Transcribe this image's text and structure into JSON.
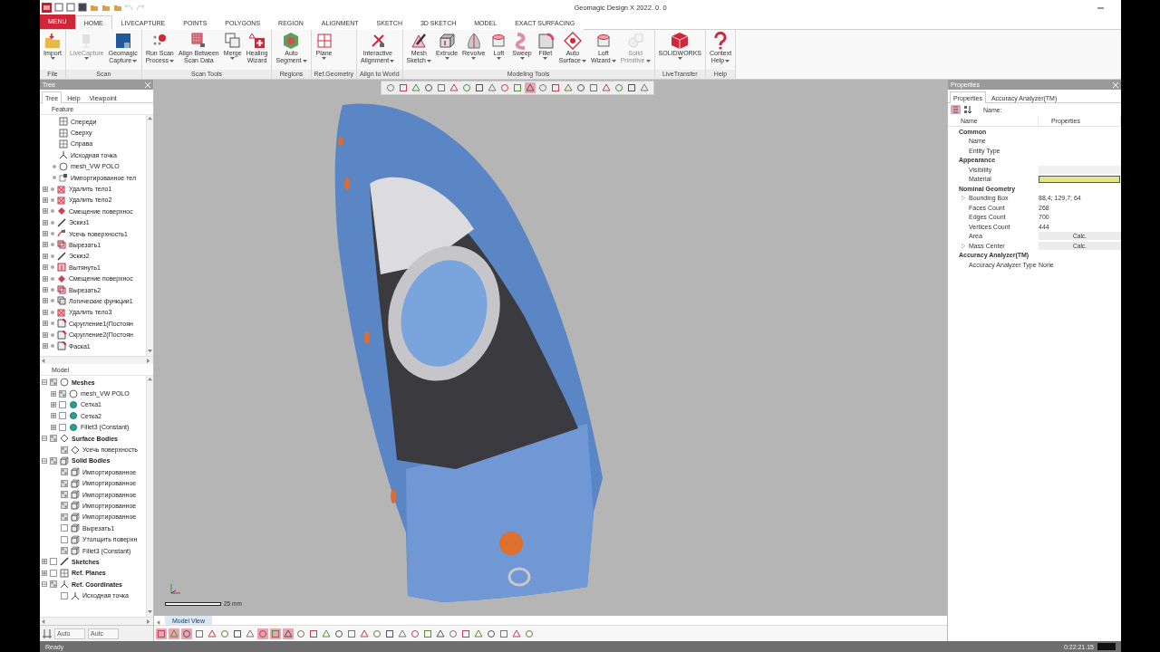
{
  "window": {
    "title": "Geomagic Design X 2022. 0. 0"
  },
  "menu_button": {
    "label": "MENU"
  },
  "ribbon_tabs": [
    {
      "label": "HOME",
      "selected": true
    },
    {
      "label": "LIVECAPTURE",
      "selected": false
    },
    {
      "label": "POINTS",
      "selected": false
    },
    {
      "label": "POLYGONS",
      "selected": false
    },
    {
      "label": "REGION",
      "selected": false
    },
    {
      "label": "ALIGNMENT",
      "selected": false
    },
    {
      "label": "SKETCH",
      "selected": false
    },
    {
      "label": "3D SKETCH",
      "selected": false
    },
    {
      "label": "MODEL",
      "selected": false
    },
    {
      "label": "EXACT SURFACING",
      "selected": false
    }
  ],
  "ribbon_groups": [
    {
      "label": "File",
      "buttons": [
        {
          "lines": [
            "Import"
          ],
          "kind": "folder",
          "dropdown": true,
          "disabled": false
        }
      ]
    },
    {
      "label": "Scan",
      "buttons": [
        {
          "lines": [
            "LiveCapture"
          ],
          "kind": "scanner",
          "dropdown": true,
          "disabled": true
        },
        {
          "lines": [
            "Geomagic",
            "Capture"
          ],
          "kind": "badge",
          "dropdown": true,
          "disabled": false
        }
      ]
    },
    {
      "label": "Scan Tools",
      "buttons": [
        {
          "lines": [
            "Run Scan",
            "Process"
          ],
          "kind": "dots",
          "dropdown": true,
          "disabled": false
        },
        {
          "lines": [
            "Align Between",
            "Scan Data"
          ],
          "kind": "grid",
          "dropdown": false,
          "disabled": false
        },
        {
          "lines": [
            "Merge"
          ],
          "kind": "overlap",
          "dropdown": true,
          "disabled": false
        },
        {
          "lines": [
            "Healing",
            "Wizard"
          ],
          "kind": "cross",
          "dropdown": false,
          "disabled": false
        }
      ]
    },
    {
      "label": "Regions",
      "buttons": [
        {
          "lines": [
            "Auto",
            "Segment"
          ],
          "kind": "hexagon",
          "dropdown": true,
          "disabled": false
        }
      ]
    },
    {
      "label": "Ref.Geometry",
      "buttons": [
        {
          "lines": [
            "Plane"
          ],
          "kind": "plane",
          "dropdown": true,
          "disabled": false
        }
      ]
    },
    {
      "label": "Align to World",
      "buttons": [
        {
          "lines": [
            "Interactive",
            "Alignment"
          ],
          "kind": "arrows",
          "dropdown": true,
          "disabled": false
        }
      ]
    },
    {
      "label": "Modeling Tools",
      "buttons": [
        {
          "lines": [
            "Mesh",
            "Sketch"
          ],
          "kind": "pen",
          "dropdown": true,
          "disabled": false
        },
        {
          "lines": [
            "Extrude"
          ],
          "kind": "box",
          "dropdown": true,
          "disabled": false
        },
        {
          "lines": [
            "Revolve"
          ],
          "kind": "petal",
          "dropdown": true,
          "disabled": false
        },
        {
          "lines": [
            "Loft"
          ],
          "kind": "cylinder",
          "dropdown": true,
          "disabled": false
        },
        {
          "lines": [
            "Sweep"
          ],
          "kind": "sweep",
          "dropdown": true,
          "disabled": false
        },
        {
          "lines": [
            "Fillet"
          ],
          "kind": "round",
          "dropdown": true,
          "disabled": false
        },
        {
          "lines": [
            "Auto",
            "Surface"
          ],
          "kind": "diamond",
          "dropdown": true,
          "disabled": false
        },
        {
          "lines": [
            "Loft",
            "Wizard"
          ],
          "kind": "cylinder",
          "dropdown": true,
          "disabled": false
        },
        {
          "lines": [
            "Solid",
            "Primitive"
          ],
          "kind": "sphere",
          "dropdown": true,
          "disabled": true
        }
      ]
    },
    {
      "label": "LiveTransfer",
      "buttons": [
        {
          "lines": [
            "SOLIDWORKS"
          ],
          "kind": "cube",
          "dropdown": true,
          "disabled": false
        }
      ]
    },
    {
      "label": "Help",
      "buttons": [
        {
          "lines": [
            "Context",
            "Help"
          ],
          "kind": "question",
          "dropdown": true,
          "disabled": false
        }
      ]
    }
  ],
  "tree_panel": {
    "title": "Tree",
    "tabs": [
      {
        "label": "Tree",
        "selected": true
      },
      {
        "label": "Help",
        "selected": false
      },
      {
        "label": "Viewpoint",
        "selected": false
      }
    ],
    "feature_header": "Feature",
    "features": [
      {
        "label": "Спереди",
        "kind": "plane",
        "dot": false,
        "expandable": false
      },
      {
        "label": "Сверху",
        "kind": "plane",
        "dot": false,
        "expandable": false
      },
      {
        "label": "Справа",
        "kind": "plane",
        "dot": false,
        "expandable": false
      },
      {
        "label": "Исходная точка",
        "kind": "origin",
        "dot": false,
        "expandable": false
      },
      {
        "label": "mesh_VW POLO",
        "kind": "mesh",
        "dot": true,
        "expandable": false
      },
      {
        "label": "Импортированное тел",
        "kind": "import",
        "dot": true,
        "expandable": false
      },
      {
        "label": "Удалить тело1",
        "kind": "delete",
        "dot": true,
        "expandable": true
      },
      {
        "label": "Удалить тело2",
        "kind": "delete",
        "dot": true,
        "expandable": true
      },
      {
        "label": "Смещение поверхнос",
        "kind": "offset",
        "dot": true,
        "expandable": true
      },
      {
        "label": "Эскиз1",
        "kind": "sketch",
        "dot": true,
        "expandable": true
      },
      {
        "label": "Усечь поверхность1",
        "kind": "trim",
        "dot": true,
        "expandable": true
      },
      {
        "label": "Вырезать1",
        "kind": "cut",
        "dot": true,
        "expandable": true
      },
      {
        "label": "Эскиз2",
        "kind": "sketch",
        "dot": true,
        "expandable": true
      },
      {
        "label": "Вытянуть1",
        "kind": "extrude",
        "dot": true,
        "expandable": true
      },
      {
        "label": "Смещение поверхнос",
        "kind": "offset",
        "dot": true,
        "expandable": true
      },
      {
        "label": "Вырезать2",
        "kind": "cut",
        "dot": true,
        "expandable": true
      },
      {
        "label": "Логические функции1",
        "kind": "boolean",
        "dot": true,
        "expandable": true
      },
      {
        "label": "Удалить тело3",
        "kind": "delete",
        "dot": true,
        "expandable": true
      },
      {
        "label": "Скругление1(Постоян",
        "kind": "fillet",
        "dot": true,
        "expandable": true
      },
      {
        "label": "Скругление2(Постоян",
        "kind": "fillet",
        "dot": true,
        "expandable": true
      },
      {
        "label": "Фаска1",
        "kind": "fillet",
        "dot": true,
        "expandable": true
      }
    ],
    "model_header": "Model",
    "model": [
      {
        "label": "Meshes",
        "kind": "mesh",
        "expandable": true,
        "expanded": true,
        "checked": true,
        "children": [
          {
            "label": "mesh_VW POLO",
            "kind": "mesh",
            "expandable": true,
            "expanded": false,
            "checked": true
          },
          {
            "label": "Сетка1",
            "kind": "ball",
            "expandable": true,
            "expanded": false,
            "checked": false
          },
          {
            "label": "Сетка2",
            "kind": "ball",
            "expandable": true,
            "expanded": false,
            "checked": false
          },
          {
            "label": "Fillet3 (Constant)",
            "kind": "ball",
            "expandable": true,
            "expanded": false,
            "checked": false
          }
        ]
      },
      {
        "label": "Surface Bodies",
        "kind": "surface",
        "expandable": true,
        "expanded": true,
        "checked": true,
        "children": [
          {
            "label": "Усечь поверхность",
            "kind": "surface",
            "expandable": false,
            "checked": true
          }
        ]
      },
      {
        "label": "Solid Bodies",
        "kind": "solid",
        "expandable": true,
        "expanded": true,
        "checked": true,
        "children": [
          {
            "label": "Импортированное",
            "kind": "solid",
            "expandable": false,
            "checked": true
          },
          {
            "label": "Импортированное",
            "kind": "solid",
            "expandable": false,
            "checked": true
          },
          {
            "label": "Импортированное",
            "kind": "solid",
            "expandable": false,
            "checked": true
          },
          {
            "label": "Импортированное",
            "kind": "solid",
            "expandable": false,
            "checked": true
          },
          {
            "label": "Импортированное",
            "kind": "solid",
            "expandable": false,
            "checked": true
          },
          {
            "label": "Вырезать1",
            "kind": "solid",
            "expandable": false,
            "checked": false
          },
          {
            "label": "Утолщить поверхн",
            "kind": "solid",
            "expandable": false,
            "checked": false
          },
          {
            "label": "Fillet3 (Constant)",
            "kind": "solid",
            "expandable": false,
            "checked": true
          }
        ]
      },
      {
        "label": "Sketches",
        "kind": "sketch",
        "expandable": true,
        "expanded": false,
        "checked": false
      },
      {
        "label": "Ref. Planes",
        "kind": "plane",
        "expandable": true,
        "expanded": false,
        "checked": false
      },
      {
        "label": "Ref. Coordinates",
        "kind": "origin",
        "expandable": true,
        "expanded": true,
        "checked": true,
        "children": [
          {
            "label": "Исходная точка",
            "kind": "origin",
            "expandable": false,
            "checked": false
          }
        ]
      }
    ],
    "bottom_fields": [
      {
        "value": "Auto"
      },
      {
        "value": "Autc"
      }
    ]
  },
  "viewport": {
    "view_toolbar": [
      {
        "on": false
      },
      {
        "on": false
      },
      {
        "on": false
      },
      {
        "on": false
      },
      {
        "on": false
      },
      {
        "on": false
      },
      {
        "on": false
      },
      {
        "on": false
      },
      {
        "on": false
      },
      {
        "on": false
      },
      {
        "on": false
      },
      {
        "on": true
      },
      {
        "on": false
      },
      {
        "on": false
      },
      {
        "on": false
      },
      {
        "on": false
      },
      {
        "on": false
      },
      {
        "on": false
      },
      {
        "on": false
      },
      {
        "on": false
      },
      {
        "on": false
      }
    ],
    "scale_label": "25 mm",
    "tab": {
      "label": "Model View",
      "selected": true
    },
    "bottom_toolbar": [
      {
        "on": true
      },
      {
        "on": true
      },
      {
        "on": true
      },
      {
        "on": false
      },
      {
        "on": false
      },
      {
        "on": false
      },
      {
        "on": false
      },
      {
        "on": false
      },
      {
        "on": true
      },
      {
        "on": true
      },
      {
        "on": true
      },
      {
        "on": false
      },
      {
        "on": false
      },
      {
        "on": false
      },
      {
        "on": false
      },
      {
        "on": false
      },
      {
        "on": false
      },
      {
        "on": false
      },
      {
        "on": false
      },
      {
        "on": false
      },
      {
        "on": false
      },
      {
        "on": false
      },
      {
        "on": false
      },
      {
        "on": false
      },
      {
        "on": false
      },
      {
        "on": false
      },
      {
        "on": false
      },
      {
        "on": false
      },
      {
        "on": false
      },
      {
        "on": false
      }
    ]
  },
  "properties_panel": {
    "title": "Properties",
    "tabs": [
      {
        "label": "Properties",
        "selected": true
      },
      {
        "label": "Accuracy Analyzer(TM)",
        "selected": false
      }
    ],
    "name_label": "Name:",
    "columns": [
      "Name",
      "Properties"
    ],
    "groups": [
      {
        "label": "Common",
        "rows": [
          {
            "name": "Name",
            "kind": "empty"
          },
          {
            "name": "Entity Type",
            "kind": "empty"
          }
        ]
      },
      {
        "label": "Appearance",
        "rows": [
          {
            "name": "Visibility",
            "kind": "field"
          },
          {
            "name": "Material",
            "kind": "swatch",
            "color": "#e4e48a"
          }
        ]
      },
      {
        "label": "Nominal Geometry",
        "rows": [
          {
            "name": "Bounding Box",
            "kind": "text",
            "value": "88,4; 129,7; 64",
            "expandable": true
          },
          {
            "name": "Faces Count",
            "kind": "text",
            "value": "268",
            "expandable": false
          },
          {
            "name": "Edges Count",
            "kind": "text",
            "value": "700",
            "expandable": false
          },
          {
            "name": "Vertices Count",
            "kind": "text",
            "value": "444",
            "expandable": false
          },
          {
            "name": "Area",
            "kind": "button",
            "value": "Calc.",
            "expandable": false
          },
          {
            "name": "Mass Center",
            "kind": "button",
            "value": "Calc.",
            "expandable": true
          }
        ]
      },
      {
        "label": "Accuracy Analyzer(TM)",
        "rows": [
          {
            "name": "Accuracy Analyzer Type",
            "kind": "text",
            "value": "None"
          }
        ]
      }
    ]
  },
  "status_bar": {
    "message": "Ready",
    "time": "0:22:21.15"
  }
}
